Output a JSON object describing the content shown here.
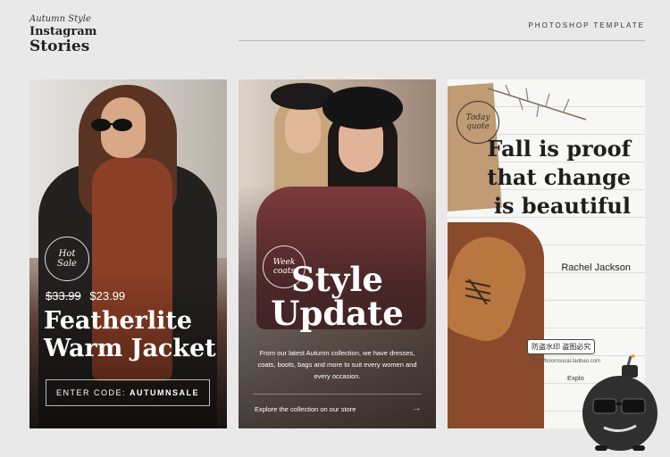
{
  "brand": {
    "script_line": "Autumn Style",
    "line2": "Instagram",
    "line3": "Stories"
  },
  "header": {
    "label": "PHOTOSHOP TEMPLATE"
  },
  "card1": {
    "badge_line1": "Hot",
    "badge_line2": "Sale",
    "price_old": "$33.99",
    "price_new": "$23.99",
    "title": "Featherlite Warm Jacket",
    "code_prefix": "ENTER CODE:",
    "code": "AUTUMNSALE"
  },
  "card2": {
    "badge_line1": "Week",
    "badge_line2": "coats",
    "title": "Style Update",
    "body": "From our latest Autumn collection, we have dresses, coats, boots, bags and more to suit every women and every occasion.",
    "explore": "Explore the collection on our store",
    "arrow": "→"
  },
  "card3": {
    "stamp_line1": "Today",
    "stamp_line2": "quote",
    "quote": "Fall is proof that change is beautiful",
    "author": "Rachel Jackson",
    "explore": "Explo"
  },
  "watermark": {
    "label": "防盗水印 盗图必究",
    "url": "https://boomsucai.taobao.com"
  }
}
